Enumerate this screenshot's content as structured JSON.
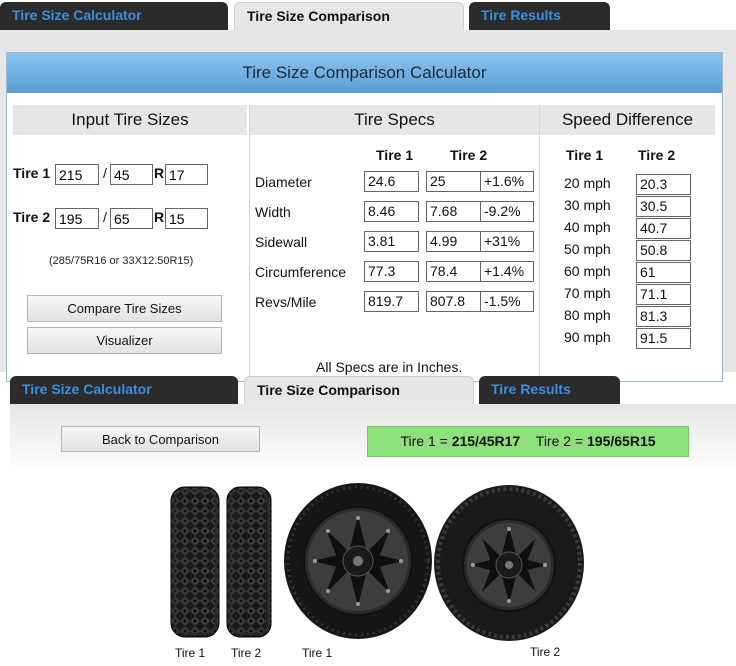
{
  "top_tabs": [
    "Tire Size Calculator",
    "Tire Size Comparison",
    "Tire Results"
  ],
  "calculator": {
    "title": "Tire Size Comparison Calculator",
    "input_section": {
      "heading": "Input Tire Sizes",
      "tire1": {
        "label": "Tire 1",
        "width": "215",
        "ratio": "45",
        "rim": "17"
      },
      "tire2": {
        "label": "Tire 2",
        "width": "195",
        "ratio": "65",
        "rim": "15"
      },
      "slash": "/",
      "r_label": "R",
      "hint": "(285/75R16 or 33X12.50R15)",
      "compare_button": "Compare Tire Sizes",
      "visualizer_button": "Visualizer"
    },
    "specs_section": {
      "heading": "Tire Specs",
      "col_tire1": "Tire 1",
      "col_tire2": "Tire 2",
      "rows": [
        {
          "label": "Diameter",
          "tire1": "24.6",
          "tire2": "25",
          "diff": "+1.6%"
        },
        {
          "label": "Width",
          "tire1": "8.46",
          "tire2": "7.68",
          "diff": "-9.2%"
        },
        {
          "label": "Sidewall",
          "tire1": "3.81",
          "tire2": "4.99",
          "diff": "+31%"
        },
        {
          "label": "Circumference",
          "tire1": "77.3",
          "tire2": "78.4",
          "diff": "+1.4%"
        },
        {
          "label": "Revs/Mile",
          "tire1": "819.7",
          "tire2": "807.8",
          "diff": "-1.5%"
        }
      ],
      "footnote": "All Specs are in Inches."
    },
    "speed_section": {
      "heading": "Speed Difference",
      "col_tire1": "Tire 1",
      "col_tire2": "Tire 2",
      "rows": [
        {
          "tire1": "20 mph",
          "tire2": "20.3"
        },
        {
          "tire1": "30 mph",
          "tire2": "30.5"
        },
        {
          "tire1": "40 mph",
          "tire2": "40.7"
        },
        {
          "tire1": "50 mph",
          "tire2": "50.8"
        },
        {
          "tire1": "60 mph",
          "tire2": "61"
        },
        {
          "tire1": "70 mph",
          "tire2": "71.1"
        },
        {
          "tire1": "80 mph",
          "tire2": "81.3"
        },
        {
          "tire1": "90 mph",
          "tire2": "91.5"
        }
      ]
    }
  },
  "bottom_tabs": [
    "Tire Size Calculator",
    "Tire Size Comparison",
    "Tire Results"
  ],
  "visualizer": {
    "back_button": "Back to Comparison",
    "banner": {
      "t1_label": "Tire 1 = ",
      "t1_size": "215/45R17",
      "t2_label": "Tire 2 = ",
      "t2_size": "195/65R15"
    },
    "captions": [
      "Tire 1",
      "Tire 2",
      "Tire 1",
      "Tire 2"
    ]
  },
  "colors": {
    "tab_dark": "#2b2b2b",
    "tab_link": "#3a8fe0",
    "header_blue": "#6fb0e4",
    "banner_green": "#8ee07d"
  }
}
